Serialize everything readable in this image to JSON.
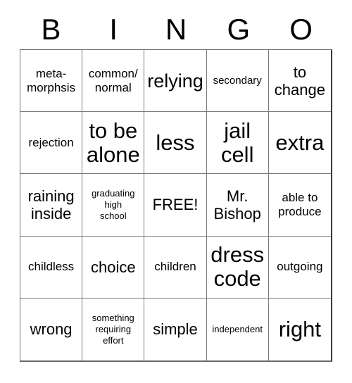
{
  "header": {
    "letters": [
      "B",
      "I",
      "N",
      "G",
      "O"
    ]
  },
  "grid": {
    "rows": 5,
    "columns": 5,
    "free_space_index": 12,
    "cells": [
      {
        "text": "meta-\nmorphsis",
        "size": "fs-sm"
      },
      {
        "text": "common/\nnormal",
        "size": "fs-sm"
      },
      {
        "text": "relying",
        "size": "fs-lg"
      },
      {
        "text": "secondary",
        "size": "fs-xs"
      },
      {
        "text": "to\nchange",
        "size": "fs-md"
      },
      {
        "text": "rejection",
        "size": "fs-sm"
      },
      {
        "text": "to be\nalone",
        "size": "fs-xl"
      },
      {
        "text": "less",
        "size": "fs-xl"
      },
      {
        "text": "jail\ncell",
        "size": "fs-xl"
      },
      {
        "text": "extra",
        "size": "fs-xl"
      },
      {
        "text": "raining\ninside",
        "size": "fs-md"
      },
      {
        "text": "graduating\nhigh\nschool",
        "size": "fs-xxs"
      },
      {
        "text": "FREE!",
        "size": "fs-md"
      },
      {
        "text": "Mr.\nBishop",
        "size": "fs-md"
      },
      {
        "text": "able to\nproduce",
        "size": "fs-sm"
      },
      {
        "text": "childless",
        "size": "fs-sm"
      },
      {
        "text": "choice",
        "size": "fs-md"
      },
      {
        "text": "children",
        "size": "fs-sm"
      },
      {
        "text": "dress\ncode",
        "size": "fs-xl"
      },
      {
        "text": "outgoing",
        "size": "fs-sm"
      },
      {
        "text": "wrong",
        "size": "fs-md"
      },
      {
        "text": "something\nrequiring\neffort",
        "size": "fs-xxs"
      },
      {
        "text": "simple",
        "size": "fs-md"
      },
      {
        "text": "independent",
        "size": "fs-xxs"
      },
      {
        "text": "right",
        "size": "fs-xl"
      }
    ]
  },
  "colors": {
    "background": "#ffffff",
    "text": "#000000",
    "grid_line": "#7a7a7a",
    "grid_outer": "#3a3a3a"
  }
}
